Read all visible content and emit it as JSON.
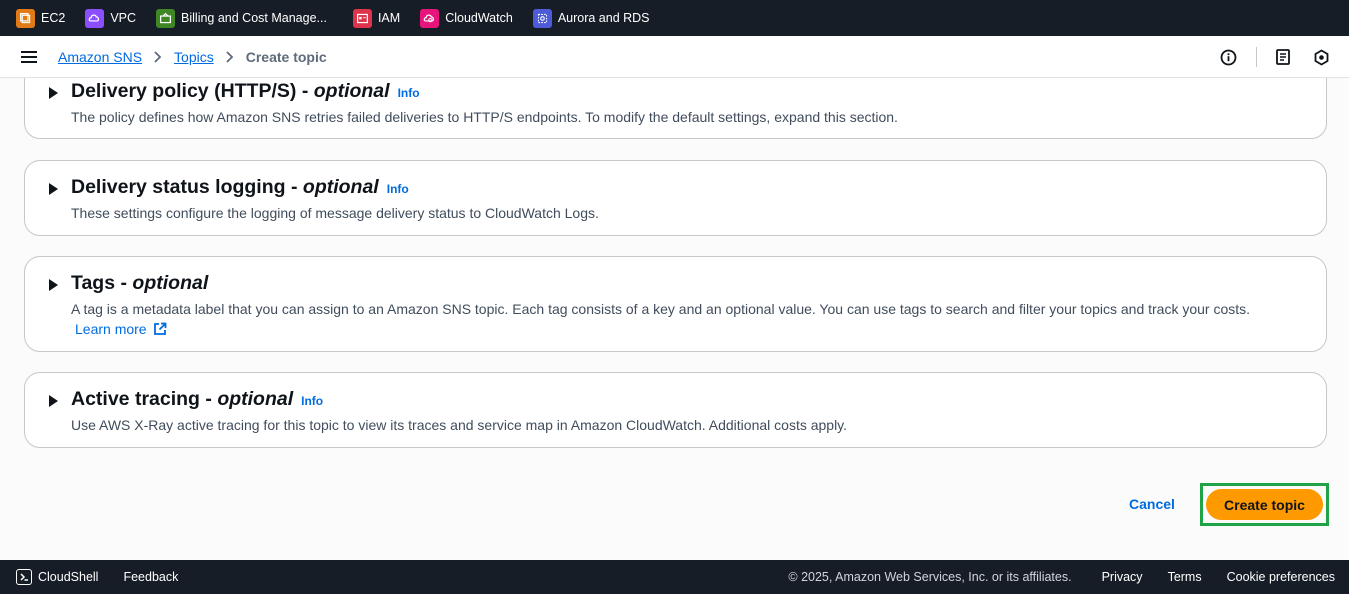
{
  "services": [
    {
      "label": "EC2",
      "color": "#e07b17",
      "icon": "ec2-icon"
    },
    {
      "label": "VPC",
      "color": "#8c4fff",
      "icon": "vpc-icon"
    },
    {
      "label": "Billing and Cost Manage...",
      "color": "#3f8624",
      "icon": "billing-icon"
    },
    {
      "label": "IAM",
      "color": "#dd344c",
      "icon": "iam-icon"
    },
    {
      "label": "CloudWatch",
      "color": "#e7157b",
      "icon": "cloudwatch-icon"
    },
    {
      "label": "Aurora and RDS",
      "color": "#4d5bd9",
      "icon": "rds-icon"
    }
  ],
  "breadcrumb": {
    "root": "Amazon SNS",
    "parent": "Topics",
    "current": "Create topic"
  },
  "panels": [
    {
      "title": "Delivery policy (HTTP/S)",
      "optional": "optional",
      "info": "Info",
      "description": "The policy defines how Amazon SNS retries failed deliveries to HTTP/S endpoints. To modify the default settings, expand this section."
    },
    {
      "title": "Delivery status logging",
      "optional": "optional",
      "info": "Info",
      "description": "These settings configure the logging of message delivery status to CloudWatch Logs."
    },
    {
      "title": "Tags",
      "optional": "optional",
      "info": "",
      "description": "A tag is a metadata label that you can assign to an Amazon SNS topic. Each tag consists of a key and an optional value. You can use tags to search and filter your topics and track your costs.",
      "learn_more": "Learn more"
    },
    {
      "title": "Active tracing",
      "optional": "optional",
      "info": "Info",
      "description": "Use AWS X-Ray active tracing for this topic to view its traces and service map in Amazon CloudWatch. Additional costs apply."
    }
  ],
  "separator": " - ",
  "actions": {
    "cancel": "Cancel",
    "create": "Create topic"
  },
  "footer": {
    "cloudshell": "CloudShell",
    "feedback": "Feedback",
    "copyright": "© 2025, Amazon Web Services, Inc. or its affiliates.",
    "privacy": "Privacy",
    "terms": "Terms",
    "cookies": "Cookie preferences"
  },
  "colors": {
    "accent": "#ff9900",
    "link": "#006ce0",
    "highlight": "#1ea446",
    "bar": "#161d26"
  }
}
